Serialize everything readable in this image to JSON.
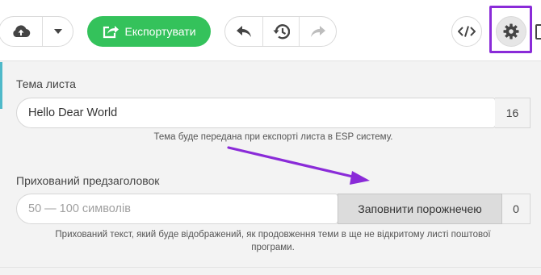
{
  "toolbar": {
    "export_label": "Експортувати",
    "colors": {
      "export_bg": "#34c25b",
      "highlight": "#8a2bd8",
      "accent": "#4fb9c9"
    }
  },
  "subject": {
    "label": "Тема листа",
    "value": "Hello Dear World",
    "count": "16",
    "help": "Тема буде передана при експорті листа в ESP систему."
  },
  "preheader": {
    "label": "Прихований предзаголовок",
    "placeholder": "50 — 100 символів",
    "fill_button": "Заповнити порожнечею",
    "count": "0",
    "help_line1": "Прихований текст, який буде відображений, як продовження теми в ще не відкритому листі поштової",
    "help_line2": "програми."
  }
}
